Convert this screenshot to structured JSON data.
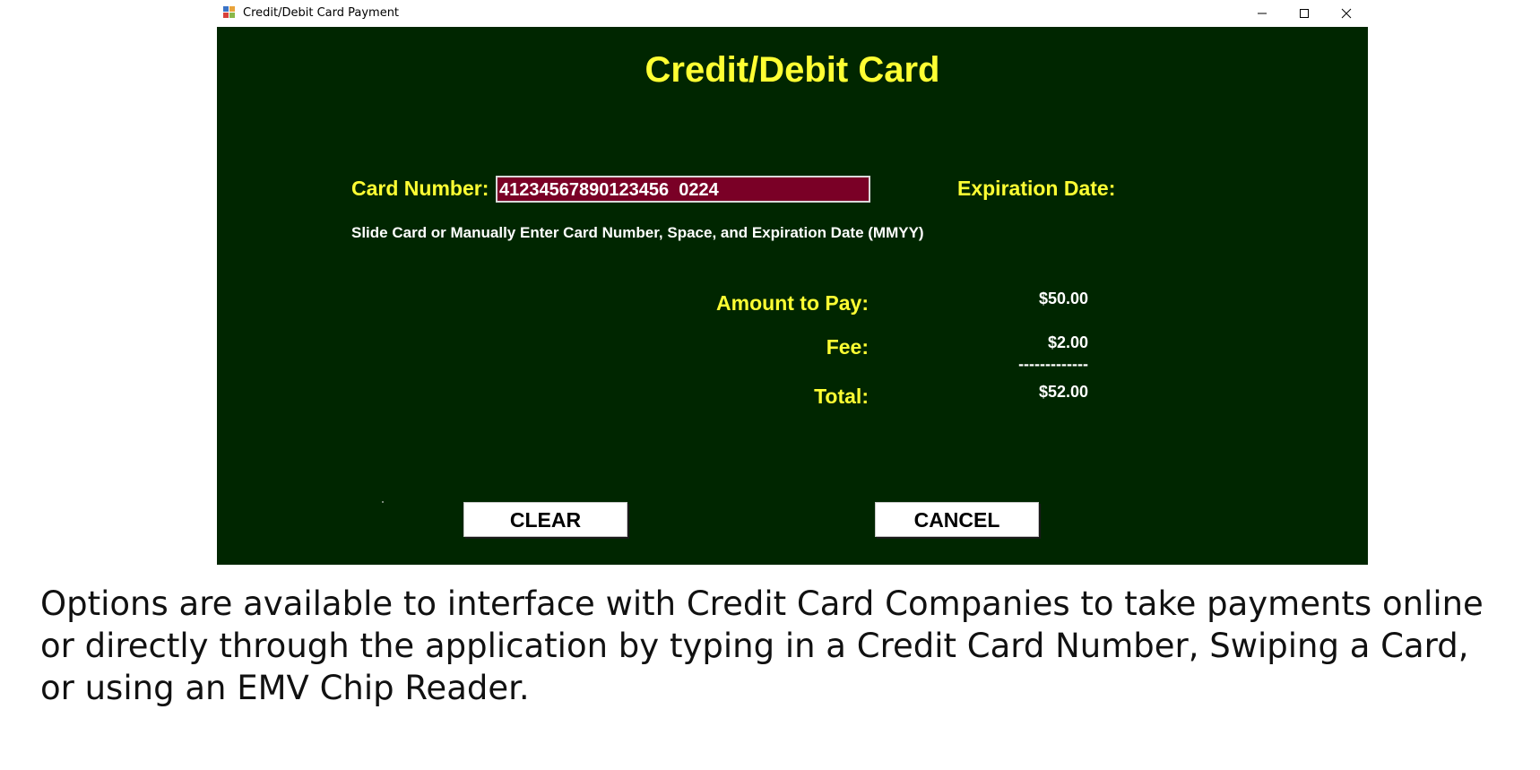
{
  "window": {
    "title": "Credit/Debit Card Payment",
    "controls": {
      "minimize": "minimize-icon",
      "maximize": "maximize-icon",
      "close": "close-icon"
    }
  },
  "form": {
    "heading": "Credit/Debit Card",
    "card_number_label": "Card Number:",
    "card_number_value": "41234567890123456  0224",
    "expiration_label": "Expiration Date:",
    "instructions": "Slide Card or Manually Enter Card Number, Space, and Expiration Date (MMYY)",
    "amount_label": "Amount to Pay:",
    "amount_value": "$50.00",
    "fee_label": "Fee:",
    "fee_value": "$2.00",
    "separator": "-------------",
    "total_label": "Total:",
    "total_value": "$52.00",
    "clear_button": "CLEAR",
    "cancel_button": "CANCEL"
  },
  "colors": {
    "background": "#002600",
    "label_yellow": "#ffff33",
    "input_background": "#7a0026",
    "text_white": "#ffffff"
  },
  "caption": "Options are available to interface with Credit Card Companies to take payments online or directly through the application by typing in a Credit Card Number, Swiping a Card, or using an EMV Chip Reader."
}
